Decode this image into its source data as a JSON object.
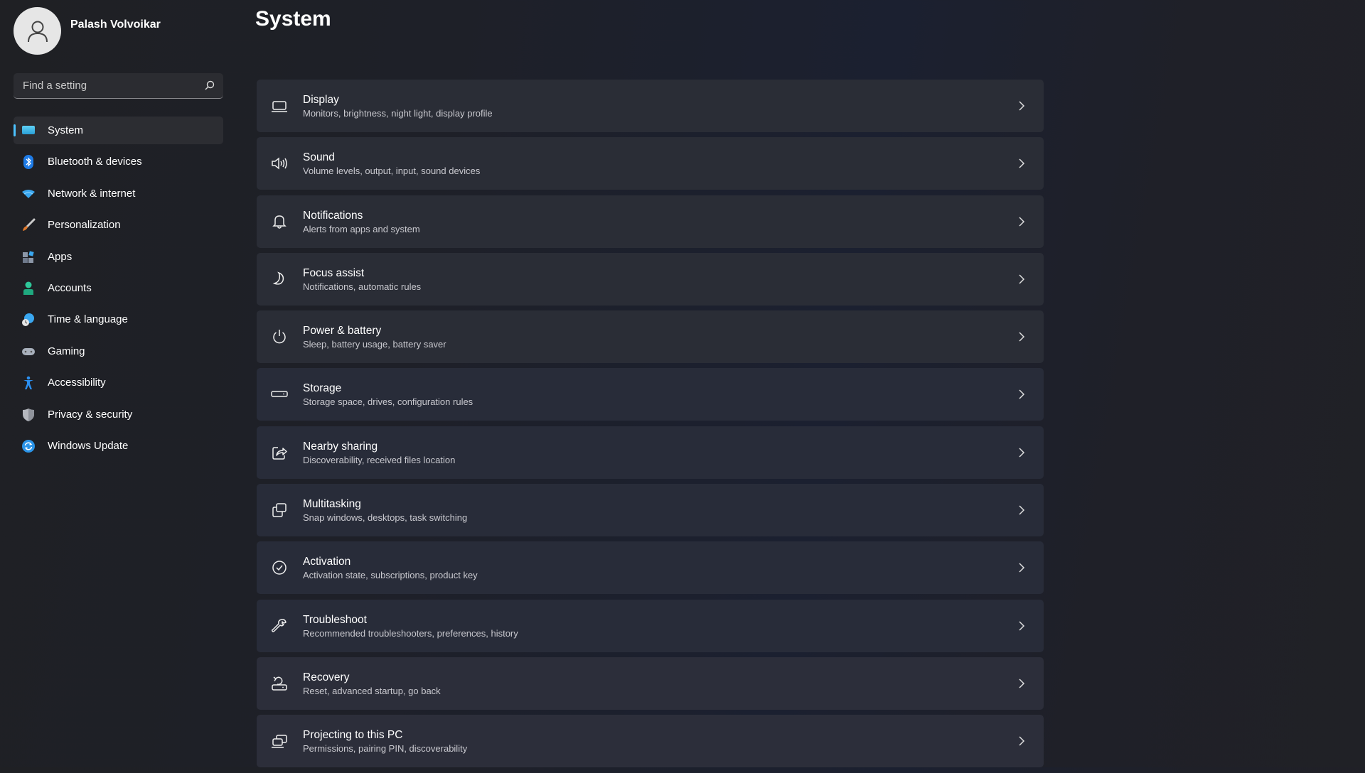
{
  "user": {
    "name": "Palash Volvoikar",
    "avatar_icon": "person-icon"
  },
  "search": {
    "placeholder": "Find a setting",
    "value": "",
    "icon": "search-icon"
  },
  "sidebar": {
    "items": [
      {
        "label": "System",
        "icon": "monitor-icon",
        "active": true
      },
      {
        "label": "Bluetooth & devices",
        "icon": "bluetooth-icon"
      },
      {
        "label": "Network & internet",
        "icon": "wifi-icon"
      },
      {
        "label": "Personalization",
        "icon": "brush-icon"
      },
      {
        "label": "Apps",
        "icon": "apps-icon"
      },
      {
        "label": "Accounts",
        "icon": "account-icon"
      },
      {
        "label": "Time & language",
        "icon": "globe-clock-icon"
      },
      {
        "label": "Gaming",
        "icon": "gamepad-icon"
      },
      {
        "label": "Accessibility",
        "icon": "accessibility-icon"
      },
      {
        "label": "Privacy & security",
        "icon": "shield-icon"
      },
      {
        "label": "Windows Update",
        "icon": "update-icon"
      }
    ]
  },
  "page": {
    "title": "System"
  },
  "settings": [
    {
      "title": "Display",
      "subtitle": "Monitors, brightness, night light, display profile",
      "icon": "laptop-icon"
    },
    {
      "title": "Sound",
      "subtitle": "Volume levels, output, input, sound devices",
      "icon": "speaker-icon"
    },
    {
      "title": "Notifications",
      "subtitle": "Alerts from apps and system",
      "icon": "bell-icon"
    },
    {
      "title": "Focus assist",
      "subtitle": "Notifications, automatic rules",
      "icon": "moon-icon"
    },
    {
      "title": "Power & battery",
      "subtitle": "Sleep, battery usage, battery saver",
      "icon": "power-icon"
    },
    {
      "title": "Storage",
      "subtitle": "Storage space, drives, configuration rules",
      "icon": "drive-icon"
    },
    {
      "title": "Nearby sharing",
      "subtitle": "Discoverability, received files location",
      "icon": "share-icon"
    },
    {
      "title": "Multitasking",
      "subtitle": "Snap windows, desktops, task switching",
      "icon": "multitask-icon"
    },
    {
      "title": "Activation",
      "subtitle": "Activation state, subscriptions, product key",
      "icon": "check-circle-icon"
    },
    {
      "title": "Troubleshoot",
      "subtitle": "Recommended troubleshooters, preferences, history",
      "icon": "wrench-icon"
    },
    {
      "title": "Recovery",
      "subtitle": "Reset, advanced startup, go back",
      "icon": "recovery-icon"
    },
    {
      "title": "Projecting to this PC",
      "subtitle": "Permissions, pairing PIN, discoverability",
      "icon": "projecting-icon"
    }
  ],
  "colors": {
    "accent": "#4cc2ff",
    "card_bg": "#2a2d36",
    "sidebar_active_bg": "#2c2d32"
  }
}
